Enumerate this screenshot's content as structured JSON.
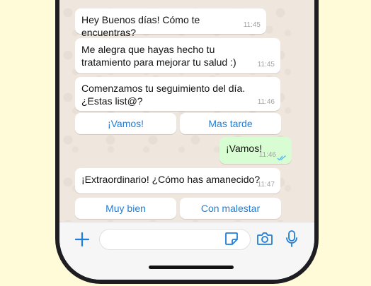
{
  "messages": [
    {
      "text": "Hey Buenos días! Cómo te encuentras?",
      "time": "11:45",
      "direction": "incoming"
    },
    {
      "text": "Me alegra que hayas hecho tu tratamiento para mejorar tu salud :)",
      "time": "11:45",
      "direction": "incoming"
    },
    {
      "text": "Comenzamos tu seguimiento del día. ¿Estas list@?",
      "time": "11:46",
      "direction": "incoming"
    },
    {
      "text": "¡Vamos!",
      "time": "11:46",
      "direction": "outgoing",
      "read": true
    },
    {
      "text": "¡Extraordinario! ¿Cómo has amanecido?",
      "time": "11:47",
      "direction": "incoming"
    }
  ],
  "quick_replies_1": [
    "¡Vamos!",
    "Mas tarde"
  ],
  "quick_replies_2": [
    "Muy bien",
    "Con malestar"
  ],
  "input_bar": {
    "icons": [
      "plus-icon",
      "sticker-icon",
      "camera-icon",
      "microphone-icon"
    ],
    "placeholder": ""
  },
  "colors": {
    "background": "#fffbd9",
    "chat_background": "#efe7de",
    "incoming_bubble": "#ffffff",
    "outgoing_bubble": "#d9fdd3",
    "accent": "#1f7ed8",
    "read_ticks": "#53bdeb"
  }
}
